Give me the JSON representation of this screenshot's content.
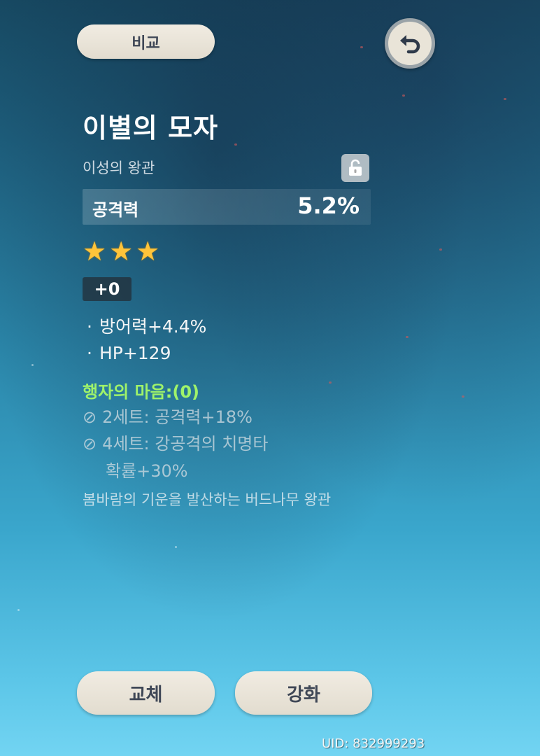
{
  "header": {
    "compare_label": "비교",
    "back_icon": "back-arrow-icon"
  },
  "artifact": {
    "name": "이별의 모자",
    "slot_type": "이성의 왕관",
    "lock_icon": "unlocked-padlock-icon",
    "main_stat": {
      "name": "공격력",
      "value": "5.2%"
    },
    "rarity_stars": 3,
    "stars": [
      "★",
      "★",
      "★"
    ],
    "level": "+0",
    "substats": [
      {
        "bullet": "·",
        "text": "방어력+4.4%"
      },
      {
        "bullet": "·",
        "text": "HP+129"
      }
    ],
    "set": {
      "name": "행자의 마음:(0)",
      "bonuses": [
        {
          "icon": "⊘",
          "text": "2세트: 공격력+18%"
        },
        {
          "icon": "⊘",
          "text": "4세트: 강공격의 치명타",
          "cont": "확률+30%"
        }
      ]
    },
    "description": "봄바람의 기운을 발산하는 버드나무 왕관"
  },
  "actions": {
    "replace_label": "교체",
    "enhance_label": "강화"
  },
  "footer": {
    "uid": "UID: 832999293"
  },
  "colors": {
    "set_name": "#9ff36a",
    "star": "#ffc43a",
    "button_bg": "#ebe5d9",
    "button_text": "#3f4756"
  }
}
